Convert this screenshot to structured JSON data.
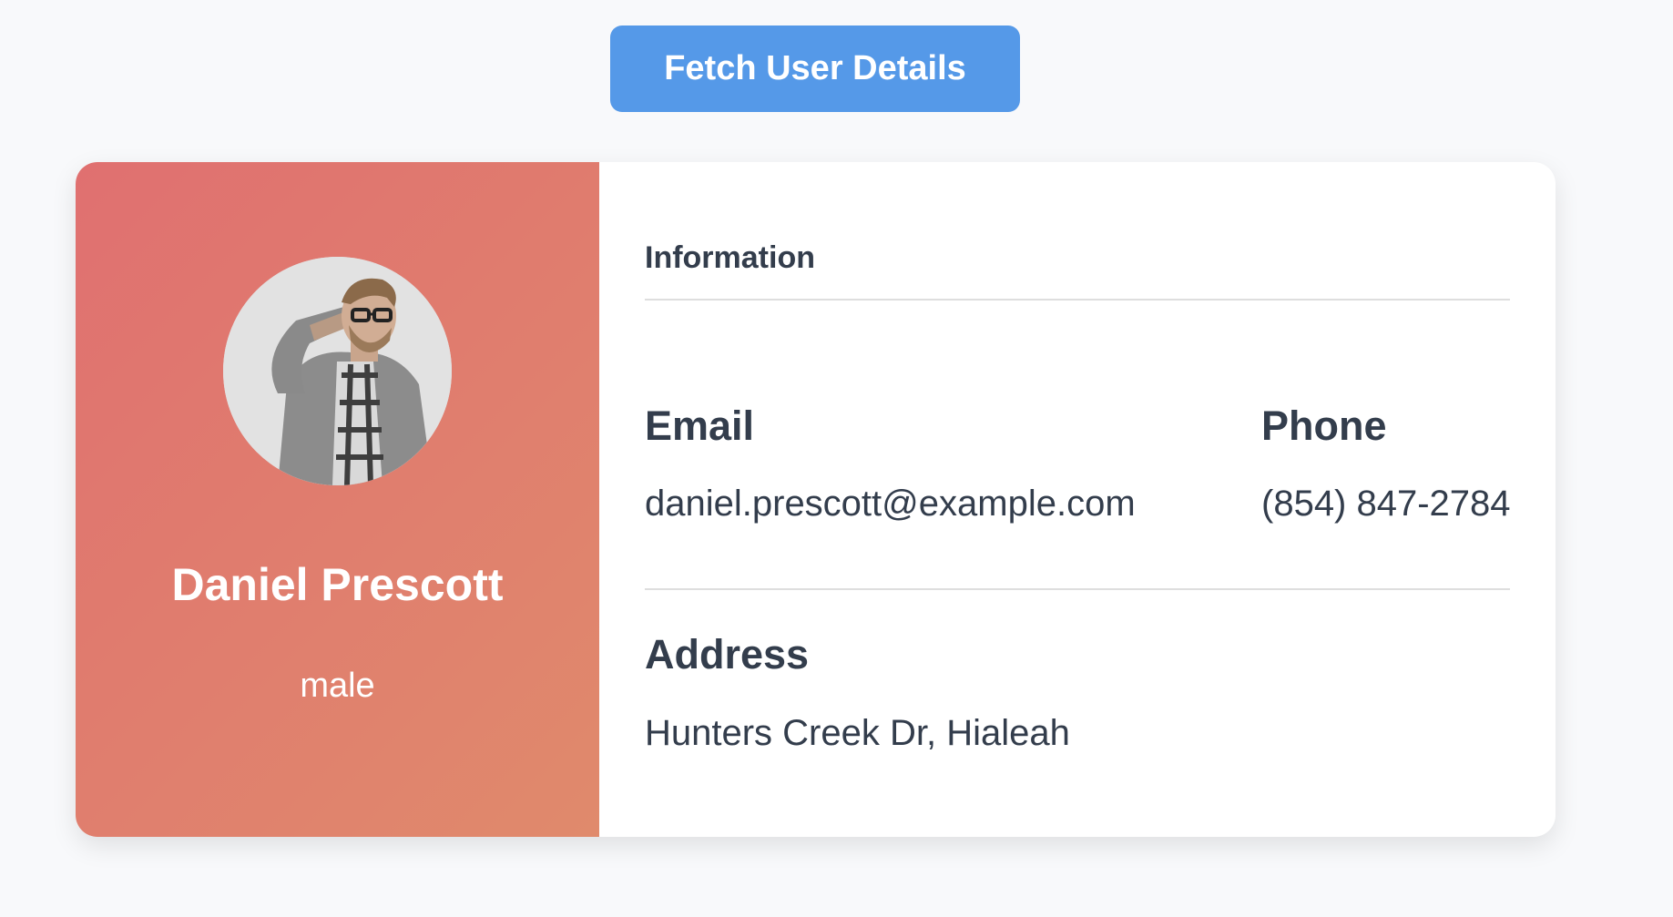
{
  "actions": {
    "fetch_button_label": "Fetch User Details"
  },
  "profile": {
    "name": "Daniel Prescott",
    "gender": "male",
    "avatar_icon": "user-photo"
  },
  "info": {
    "section_title": "Information",
    "email_label": "Email",
    "email_value": "daniel.prescott@example.com",
    "phone_label": "Phone",
    "phone_value": "(854) 847-2784",
    "address_label": "Address",
    "address_value": "Hunters Creek Dr, Hialeah"
  },
  "colors": {
    "page_background": "#f8f9fb",
    "button_blue": "#5599e8",
    "panel_gradient_start": "#e07070",
    "panel_gradient_end": "#e08a6c",
    "text_dark": "#333d4c"
  }
}
